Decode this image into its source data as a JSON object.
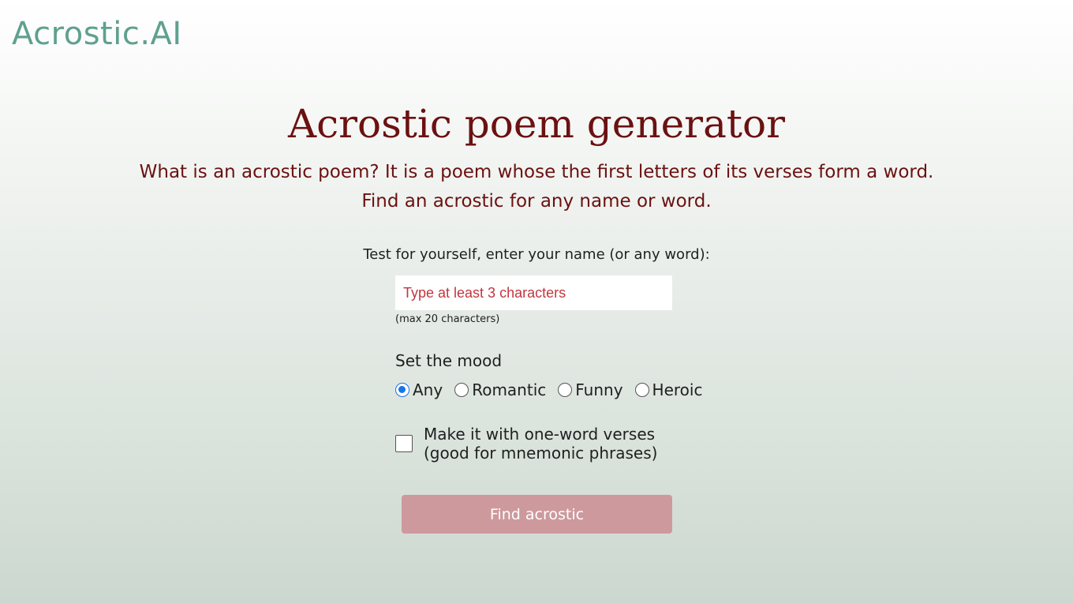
{
  "header": {
    "logo_text": "Acrostic.AI"
  },
  "main": {
    "title": "Acrostic poem generator",
    "subtitle_line1": "What is an acrostic poem? It is a poem whose the first letters of its verses form a word.",
    "subtitle_line2": "Find an acrostic for any name or word."
  },
  "form": {
    "prompt": "Test for yourself, enter your name (or any word):",
    "name_input": {
      "value": "",
      "placeholder": "Type at least 3 characters"
    },
    "max_note": "(max 20 characters)",
    "mood_label": "Set the mood",
    "moods": [
      {
        "label": "Any",
        "checked": true
      },
      {
        "label": "Romantic",
        "checked": false
      },
      {
        "label": "Funny",
        "checked": false
      },
      {
        "label": "Heroic",
        "checked": false
      }
    ],
    "one_word_checkbox": {
      "checked": false,
      "line1": "Make it with one-word verses",
      "line2": "(good for mnemonic phrases)"
    },
    "submit_label": "Find acrostic"
  },
  "colors": {
    "logo": "#5fa08f",
    "heading": "#6b1111",
    "placeholder": "#c2363e",
    "button": "#cd999d"
  }
}
